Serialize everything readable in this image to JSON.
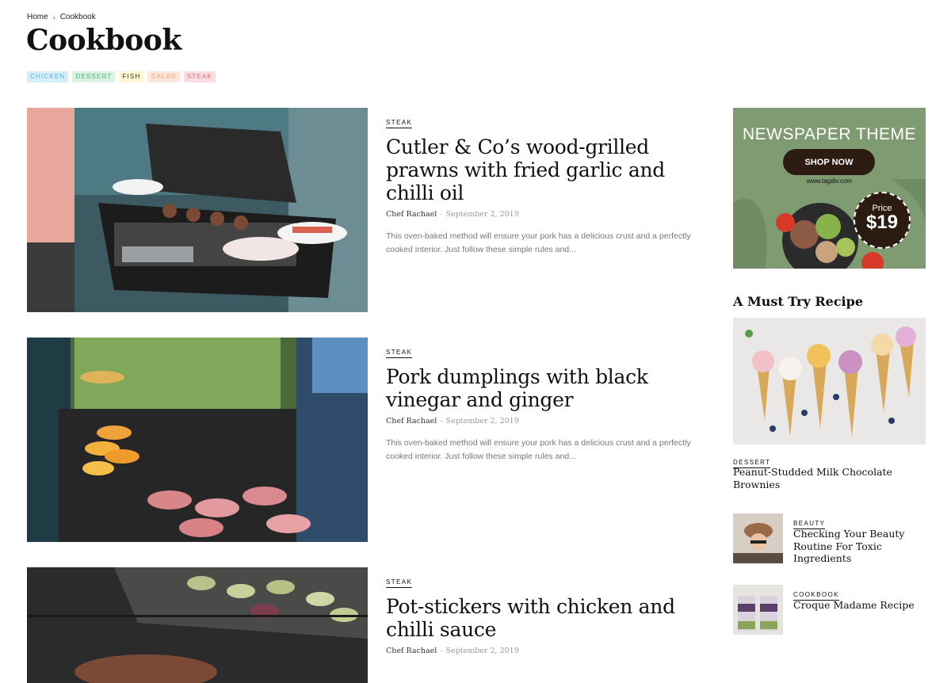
{
  "breadcrumb": {
    "home": "Home",
    "separator": "›",
    "current": "Cookbook"
  },
  "page_title": "Cookbook",
  "tags": [
    {
      "label": "CHICKEN",
      "bg": "#d6eefa",
      "color": "#5fb4df"
    },
    {
      "label": "DESSERT",
      "bg": "#d9f2e2",
      "color": "#4bb373"
    },
    {
      "label": "FISH",
      "bg": "#fbf8d3",
      "color": "#333333"
    },
    {
      "label": "SALAD",
      "bg": "#fde7dc",
      "color": "#f0a27c"
    },
    {
      "label": "STEAK",
      "bg": "#fbdde2",
      "color": "#e0707f"
    }
  ],
  "posts": [
    {
      "category": "STEAK",
      "title": "Cutler & Co’s wood-grilled prawns with fried garlic and chilli oil",
      "author": "Chef Rachael",
      "date": "September 2, 2019",
      "excerpt": "This oven-baked method will ensure your pork has a delicious crust and a perfectly cooked interior. Just follow these simple rules and..."
    },
    {
      "category": "STEAK",
      "title": "Pork dumplings with black vinegar and ginger",
      "author": "Chef Rachael",
      "date": "September 2, 2019",
      "excerpt": "This oven-baked method will ensure your pork has a delicious crust and a perfectly cooked interior. Just follow these simple rules and..."
    },
    {
      "category": "STEAK",
      "title": "Pot-stickers with chicken and chilli sauce",
      "author": "Chef Rachael",
      "date": "September 2, 2019",
      "excerpt": ""
    }
  ],
  "meta_separator": "-",
  "ad": {
    "title": "NEWSPAPER THEME",
    "button": "SHOP NOW",
    "url": "www.tagdiv.com",
    "price_label": "Price",
    "price_value": "$19"
  },
  "widget": {
    "title": "A Must Try Recipe",
    "featured": {
      "category": "DESSERT",
      "title": "Peanut-Studded Milk Chocolate Brownies"
    },
    "items": [
      {
        "category": "BEAUTY",
        "title": "Checking Your Beauty Routine For Toxic Ingredients"
      },
      {
        "category": "COOKBOOK",
        "title": "Croque Madame Recipe"
      }
    ]
  }
}
